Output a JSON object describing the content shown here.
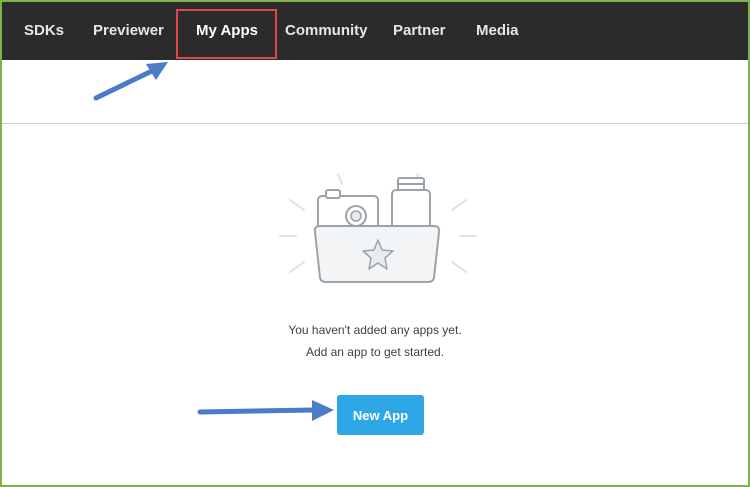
{
  "nav": {
    "items": [
      {
        "label": "SDKs"
      },
      {
        "label": "Previewer"
      },
      {
        "label": "My Apps"
      },
      {
        "label": "Community"
      },
      {
        "label": "Partner"
      },
      {
        "label": "Media"
      }
    ]
  },
  "empty_state": {
    "line1": "You haven't added any apps yet.",
    "line2": "Add an app to get started.",
    "button_label": "New App"
  },
  "colors": {
    "navbar_bg": "#2b2b2d",
    "highlight_box": "#e0474c",
    "annotation_arrow": "#4a7cc7",
    "button_bg": "#2ea7e6",
    "frame_border": "#7fb24a"
  }
}
